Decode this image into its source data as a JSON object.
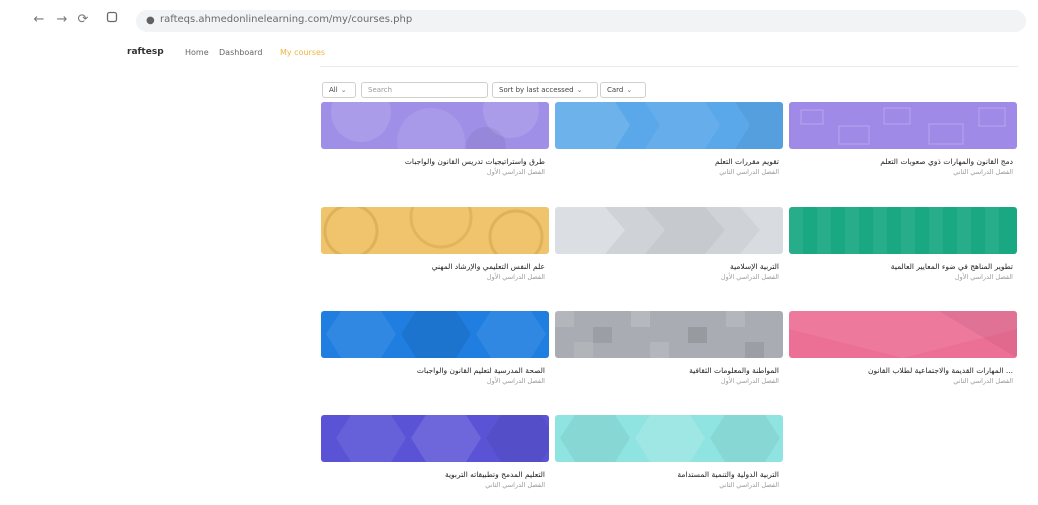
{
  "browser": {
    "back": "←",
    "forward": "→",
    "reload": "⟳",
    "url": "rafteqs.ahmedonlinelearning.com/my/courses.php"
  },
  "site": {
    "brand": "raftesp",
    "nav": [
      "Home",
      "Dashboard",
      "My courses"
    ]
  },
  "controls": {
    "filter": "All",
    "search_placeholder": "Search",
    "sort": "Sort by last accessed",
    "view": "Card"
  },
  "colors": {
    "accent": "#f0b43a"
  },
  "courses": [
    {
      "title": "طرق واستراتيجيات تدريس القانون والواجبات",
      "subtitle": "الفصل الدراسي الأول",
      "color": "#9f8fe6"
    },
    {
      "title": "تقويم مقررات التعلم",
      "subtitle": "الفصل الدراسي الثاني",
      "color": "#5aa8ea"
    },
    {
      "title": "دمج القانون والمهارات ذوي صعوبات التعلم",
      "subtitle": "الفصل الدراسي الثاني",
      "color": "#a08ae8"
    },
    {
      "title": "علم النفس التعليمي والإرشاد المهني",
      "subtitle": "الفصل الدراسي الأول",
      "color": "#f0c46c"
    },
    {
      "title": "التربية الإسلامية",
      "subtitle": "الفصل الدراسي الأول",
      "color": "#cfd3d8"
    },
    {
      "title": "تطوير المناهج في ضوء المعايير العالمية",
      "subtitle": "الفصل الدراسي الأول",
      "color": "#1aa882"
    },
    {
      "title": "الصحة المدرسية لتعليم القانون والواجبات",
      "subtitle": "الفصل الدراسي الأول",
      "color": "#1f7ee0"
    },
    {
      "title": "المواطنة والمعلومات الثقافية",
      "subtitle": "الفصل الدراسي الأول",
      "color": "#a9adb3"
    },
    {
      "title": "... المهارات القديمة والاجتماعية لطلاب القانون",
      "subtitle": "الفصل الدراسي الثاني",
      "color": "#ec6f95"
    },
    {
      "title": "التعليم المدمج وتطبيقاته التربوية",
      "subtitle": "الفصل الدراسي الثاني",
      "color": "#5a53d6"
    },
    {
      "title": "التربية الدولية والتنمية المستدامة",
      "subtitle": "الفصل الدراسي الثاني",
      "color": "#8fe3e0"
    }
  ]
}
